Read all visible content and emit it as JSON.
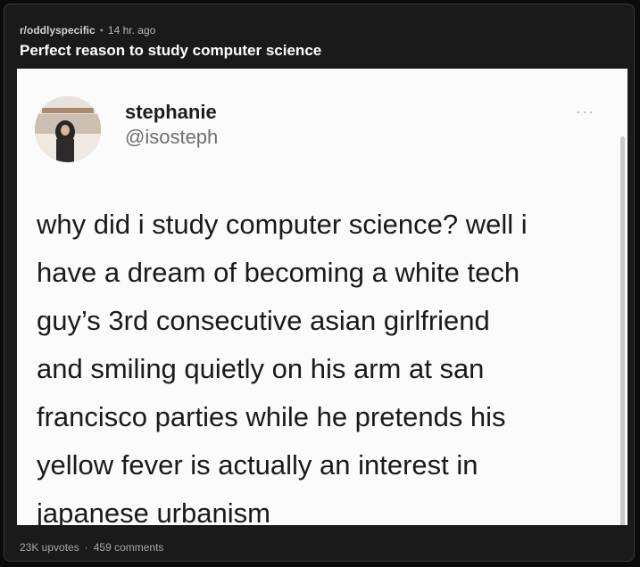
{
  "post": {
    "subreddit": "r/oddlyspecific",
    "separator": "•",
    "age": "14 hr. ago",
    "title": "Perfect reason to study computer science"
  },
  "tweet": {
    "display_name": "stephanie",
    "handle": "@isosteph",
    "more": "···",
    "lines": [
      "why did i study computer science? well i",
      "have a dream of becoming a white tech",
      "guy’s 3rd consecutive asian girlfriend",
      "and smiling quietly on his arm at san",
      "francisco parties while he pretends his",
      "yellow fever is actually an interest in",
      "japanese urbanism"
    ]
  },
  "footer": {
    "upvotes": "23K upvotes",
    "dot": "·",
    "comments": "459 comments"
  }
}
